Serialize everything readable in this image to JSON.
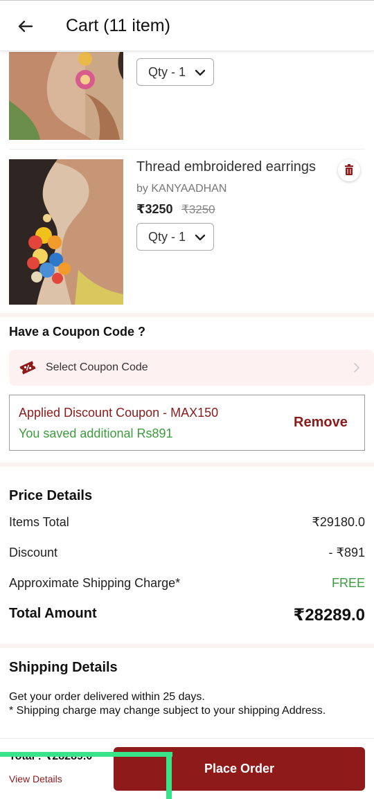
{
  "header": {
    "title": "Cart (11 item)",
    "back_icon": "arrow-left-icon"
  },
  "cart": {
    "items": [
      {
        "qty_label": "Qty - 1",
        "image": "earring-model-photo-1"
      },
      {
        "name": "Thread embroidered earrings",
        "brand": "by KANYAADHAN",
        "price": "₹3250",
        "mrp": "₹3250",
        "qty_label": "Qty - 1",
        "image": "earring-model-photo-2",
        "delete_icon": "trash-icon"
      }
    ]
  },
  "coupon": {
    "heading": "Have a Coupon Code ?",
    "select_label": "Select Coupon Code",
    "applied_title": "Applied Discount Coupon - MAX150",
    "saved_text": "You saved additional Rs891",
    "remove_label": "Remove"
  },
  "price_details": {
    "title": "Price Details",
    "rows": [
      {
        "label": "Items Total",
        "value": "₹29180.0"
      },
      {
        "label": "Discount",
        "value": "- ₹891"
      },
      {
        "label": "Approximate Shipping Charge*",
        "value": "FREE"
      }
    ],
    "total_label": "Total Amount",
    "total_value": "₹28289.0"
  },
  "shipping": {
    "title": "Shipping Details",
    "line1": "Get your order delivered within 25 days.",
    "line2": "* Shipping charge may change subject to your shipping Address."
  },
  "footer": {
    "total_text": "Total : ₹28289.0",
    "view_details": "View Details",
    "place_order": "Place Order"
  },
  "colors": {
    "brand": "#8e1a1a",
    "success": "#3d9a3d",
    "highlight_overlay": "#39e38a"
  }
}
